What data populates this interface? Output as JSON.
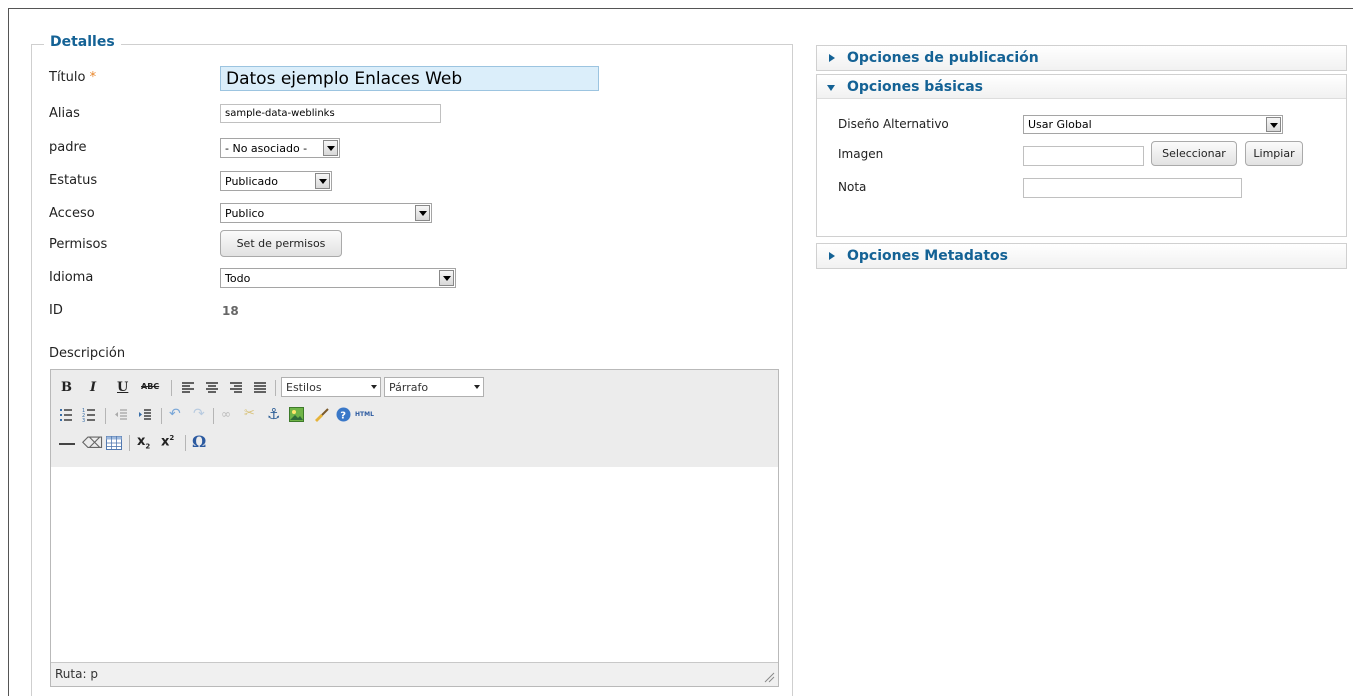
{
  "details": {
    "legend": "Detalles",
    "title_label": "Título",
    "title_required": "*",
    "title_value": "Datos ejemplo Enlaces Web",
    "alias_label": "Alias",
    "alias_value": "sample-data-weblinks",
    "parent_label": "padre",
    "parent_value": "- No asociado -",
    "status_label": "Estatus",
    "status_value": "Publicado",
    "access_label": "Acceso",
    "access_value": "Publico",
    "permissions_label": "Permisos",
    "permissions_button": "Set de permisos",
    "language_label": "Idioma",
    "language_value": "Todo",
    "id_label": "ID",
    "id_value": "18",
    "description_label": "Descripción"
  },
  "editor": {
    "styles_select": "Estilos",
    "format_select": "Párrafo",
    "html_button": "HTML",
    "path_label": "Ruta: p"
  },
  "publishing": {
    "title": "Opciones de publicación"
  },
  "basic": {
    "title": "Opciones básicas",
    "layout_label": "Diseño Alternativo",
    "layout_value": "Usar Global",
    "image_label": "Imagen",
    "image_value": "",
    "select_button": "Seleccionar",
    "clear_button": "Limpiar",
    "note_label": "Nota",
    "note_value": ""
  },
  "metadata": {
    "title": "Opciones Metadatos"
  },
  "colors": {
    "accent": "#146295",
    "required": "#e8862b"
  }
}
